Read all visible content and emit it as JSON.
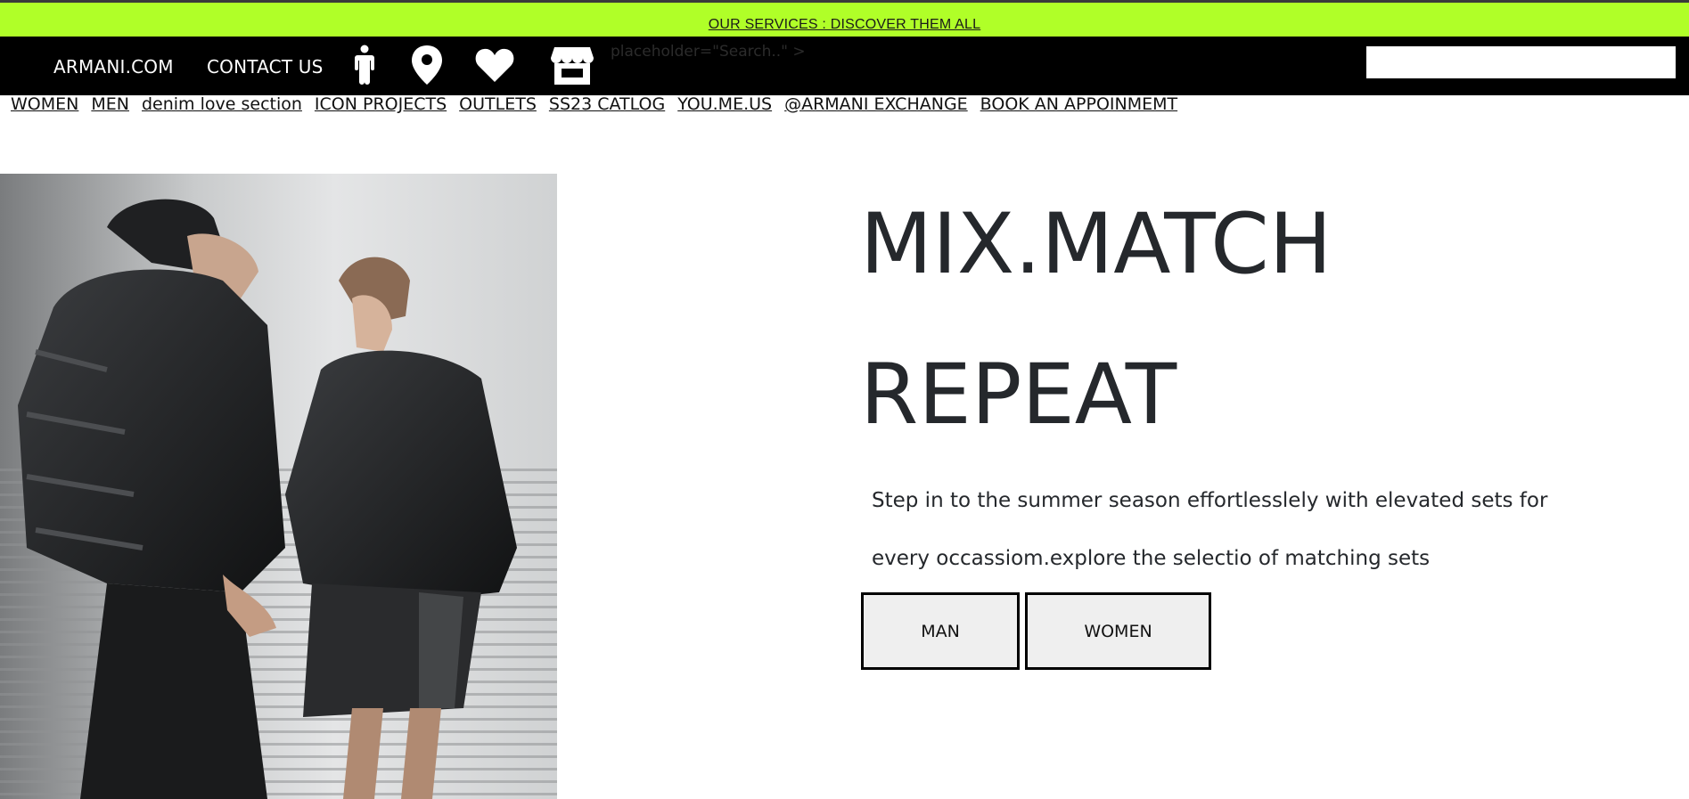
{
  "promo": {
    "text": "OUR SERVICES : DISCOVER THEM ALL"
  },
  "top_nav": {
    "armani": "ARMANI.COM",
    "contact": "CONTACT US",
    "icons": [
      "person-icon",
      "location-pin-icon",
      "heart-icon",
      "store-icon"
    ],
    "stray_text": "placeholder=\"Search..\" >",
    "search_value": ""
  },
  "categories": [
    "WOMEN",
    "MEN",
    "denim love section",
    "ICON PROJECTS",
    "OUTLETS",
    "SS23 CATLOG",
    "YOU.ME.US",
    "@ARMANI EXCHANGE",
    "BOOK AN APPOINMEMT"
  ],
  "hero": {
    "headline_1": "MIX.MATCH",
    "headline_2": "REPEAT",
    "desc_1": "Step in to the summer season effortlesslely with elevated sets for",
    "desc_2": "every occassiom.explore the selectio of matching sets",
    "btn_man": "MAN",
    "btn_women": "WOMEN"
  },
  "colors": {
    "promo_bg": "#b0ff28",
    "nav_bg": "#000000",
    "headline": "#25282c"
  }
}
